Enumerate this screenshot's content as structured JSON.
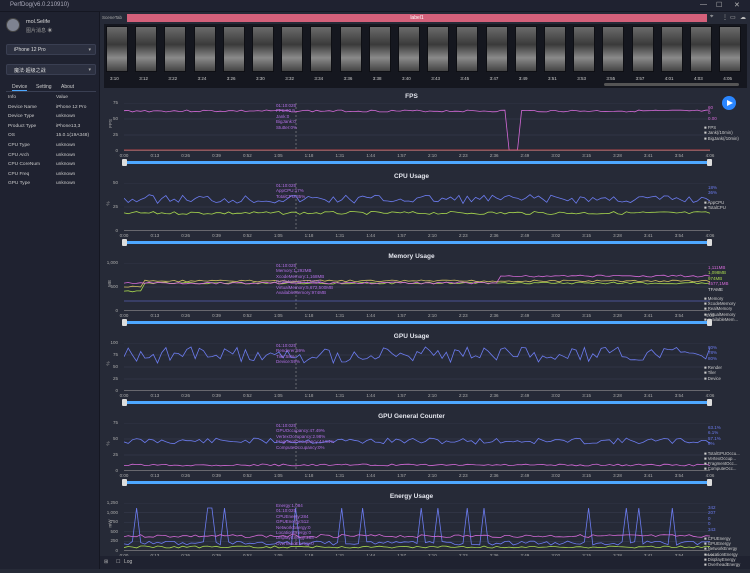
{
  "app": {
    "title": "PerfDog(v6.0.210910)"
  },
  "user": {
    "name": "mol.Selife",
    "status": "图片消息 ☀"
  },
  "device_select": "iPhone 12 Pro",
  "app_select": "魔法·超级之战",
  "sidebar_tabs": [
    "Device",
    "Setting",
    "About"
  ],
  "info_header": {
    "key": "Info",
    "value": "Value"
  },
  "info_rows": [
    {
      "k": "Device Name",
      "v": "iPhone 12 Pro"
    },
    {
      "k": "Device Type",
      "v": "unknown"
    },
    {
      "k": "Product Type",
      "v": "iPhone13,3"
    },
    {
      "k": "OS",
      "v": "15.0.1(19A348)"
    },
    {
      "k": "CPU Type",
      "v": "unknown"
    },
    {
      "k": "CPU Arch",
      "v": "unknown"
    },
    {
      "k": "CPU CoreNum",
      "v": "unknown"
    },
    {
      "k": "CPU Freq",
      "v": "unknown"
    },
    {
      "k": "GPU Type",
      "v": "unknown"
    }
  ],
  "scene": {
    "label": "SceneTab",
    "tab": "label1"
  },
  "frames": [
    "3:10",
    "3:12",
    "3:22",
    "3:24",
    "3:26",
    "3:30",
    "3:32",
    "3:34",
    "3:36",
    "3:38",
    "3:40",
    "3:43",
    "3:45",
    "3:47",
    "3:49",
    "3:51",
    "3:53",
    "3:55",
    "3:57",
    "4:01",
    "4:03",
    "4:05"
  ],
  "x_ticks": [
    "0:00",
    "0:13",
    "0:26",
    "0:39",
    "0:52",
    "1:05",
    "1:18",
    "1:31",
    "1:44",
    "1:57",
    "2:10",
    "2:23",
    "2:36",
    "2:49",
    "3:02",
    "3:15",
    "3:28",
    "3:41",
    "3:54",
    "4:06"
  ],
  "panels": [
    {
      "title": "FPS",
      "yname": "FPS",
      "yticks": [
        "75",
        "50",
        "25",
        "0"
      ],
      "tooltip": [
        "01:10:025",
        "FPS:60.9",
        "Jank:0",
        "BigJank:0",
        "Stutter:0%"
      ],
      "legend": [
        "FPS",
        "Jank(/10min)",
        "BigJank(/10min)"
      ],
      "values": [
        {
          "t": "60",
          "c": "#d46ad8"
        },
        {
          "t": "0",
          "c": "#d46ad8"
        },
        {
          "t": "0.00",
          "c": "#d46ad8"
        }
      ]
    },
    {
      "title": "CPU Usage",
      "yname": "%",
      "yticks": [
        "50",
        "25",
        "0"
      ],
      "tooltip": [
        "01:10:025",
        "AppCPU:17%",
        "TotalCPU:35%"
      ],
      "legend": [
        "AppCPU",
        "TotalCPU"
      ],
      "values": [
        {
          "t": "18%",
          "c": "#6c7cf0"
        },
        {
          "t": "36%",
          "c": "#6c7cf0"
        }
      ]
    },
    {
      "title": "Memory Usage",
      "yname": "MB",
      "yticks": [
        "1,000",
        "500",
        "0"
      ],
      "tooltip": [
        "01:10:025",
        "Memory:1,292MB",
        "XcodeMemory:1,168MB",
        "RealMemory:1,128MB",
        "VirtualMemory:5,672,500MB",
        "AvailableMemory:974MB"
      ],
      "legend": [
        "Memory",
        "XcodeMemory",
        "RealMemory",
        "VirtualMemory",
        "AvailableMem..."
      ],
      "values": [
        {
          "t": "1,111MB",
          "c": "#d46ad8"
        },
        {
          "t": "1,098MB",
          "c": "#a8d84e"
        },
        {
          "t": "974MB",
          "c": "#a8d84e"
        },
        {
          "t": "4577,1MB",
          "c": "#d46ad8"
        },
        {
          "t": "TFAME",
          "c": "#ddd"
        }
      ]
    },
    {
      "title": "GPU Usage",
      "yname": "%",
      "yticks": [
        "100",
        "75",
        "50",
        "25",
        "0"
      ],
      "tooltip": [
        "01:10:025",
        "Renderer:59%",
        "Tiler:58%",
        "Device:59%"
      ],
      "legend": [
        "Render",
        "Tiler",
        "Device"
      ],
      "values": [
        {
          "t": "80%",
          "c": "#6c7cf0"
        },
        {
          "t": "78%",
          "c": "#6c7cf0"
        },
        {
          "t": "80%",
          "c": "#6c7cf0"
        }
      ]
    },
    {
      "title": "GPU General Counter",
      "yname": "%",
      "yticks": [
        "75",
        "50",
        "25",
        "0"
      ],
      "tooltip": [
        "01:10:025",
        "GPUOccupancy:47.49%",
        "VertexOccupancy:2.98%",
        "FragmentOccupancy:44.54%",
        "ComputeOccupancy:0%"
      ],
      "legend": [
        "TotalGPUOccu...",
        "VertexOccup...",
        "FragmentOcc...",
        "ComputeOcc..."
      ],
      "values": [
        {
          "t": "63.1%",
          "c": "#6c7cf0"
        },
        {
          "t": "6.1%",
          "c": "#6c7cf0"
        },
        {
          "t": "57.1%",
          "c": "#6c7cf0"
        },
        {
          "t": "0%",
          "c": "#6c7cf0"
        }
      ]
    },
    {
      "title": "Energy Usage",
      "yname": "mW",
      "yticks": [
        "1,250",
        "1,000",
        "750",
        "500",
        "250",
        "0"
      ],
      "tooltip": [
        "Energy:1,084",
        "01:10:025",
        "CPUEnergy:284",
        "GPUEnergy:512",
        "NetworkEnergy:0",
        "LocationEnergy:0",
        "DisplayEnergy:288",
        "OverheadEnergy:0"
      ],
      "legend": [
        "CPUEnergy",
        "GPUEnergy",
        "NetworkEnergy",
        "LocationEnergy",
        "DisplayEnergy",
        "OverheadEnergy"
      ],
      "values": [
        {
          "t": "342",
          "c": "#6c7cf0"
        },
        {
          "t": "207",
          "c": "#6c7cf0"
        },
        {
          "t": "0",
          "c": "#6c7cf0"
        },
        {
          "t": "0",
          "c": "#6c7cf0"
        },
        {
          "t": "343",
          "c": "#6c7cf0"
        }
      ]
    }
  ],
  "footer": {
    "log": "Log"
  }
}
